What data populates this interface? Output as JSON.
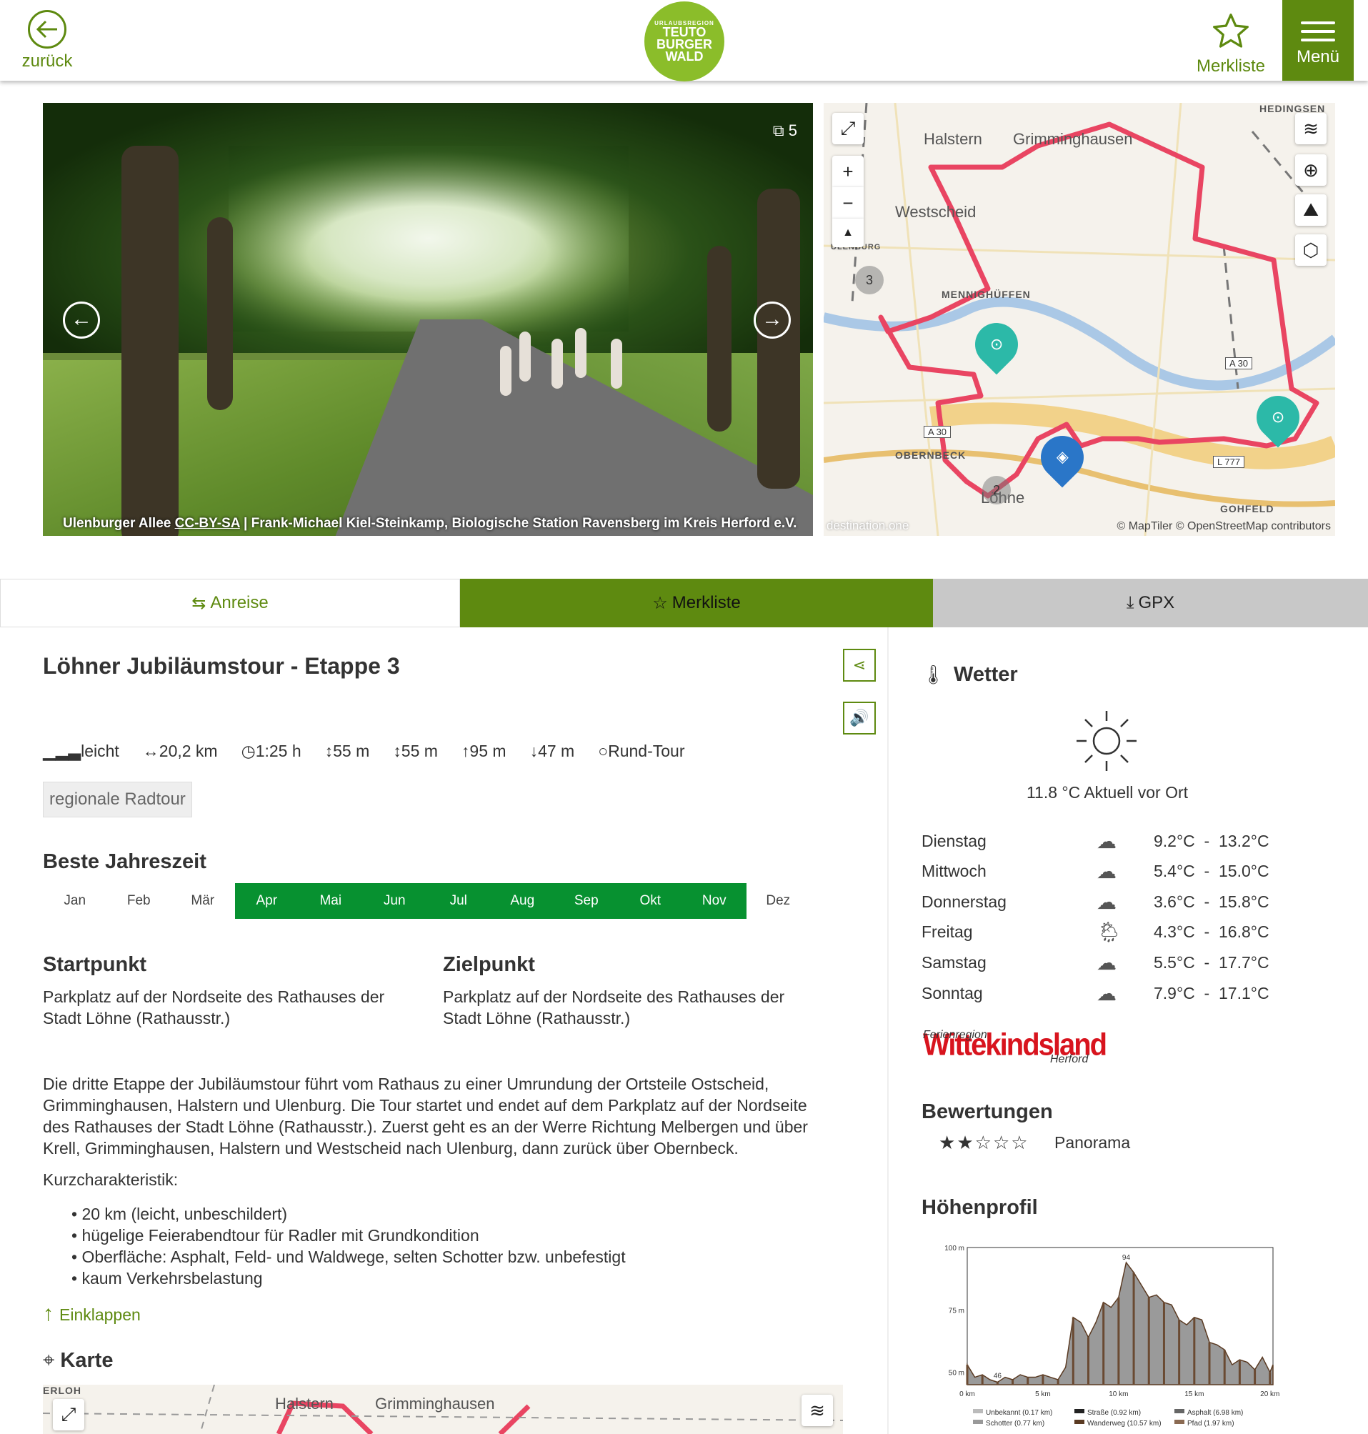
{
  "header": {
    "back_label": "zurück",
    "logo_small": "URLAUBSREGION",
    "logo_line1": "TEUTO",
    "logo_line2": "BURGER",
    "logo_line3": "WALD",
    "merkliste_label": "Merkliste",
    "menu_label": "Menü"
  },
  "gallery": {
    "count": "5",
    "caption_title": "Ulenburger Allee",
    "caption_license": "CC-BY-SA",
    "caption_author": "| Frank-Michael Kiel-Steinkamp, Biologische Station Ravensberg im Kreis Herford e.V."
  },
  "map": {
    "labels": [
      "Halstern",
      "Grimminghausen",
      "Westscheid",
      "MENNIGHÜFFEN",
      "OBERNBECK",
      "GOHFELD",
      "HEDINGSEN",
      "ULENBURG",
      "Löhne"
    ],
    "roads": [
      "A 30",
      "A 30",
      "L 777"
    ],
    "clusters": [
      "3",
      "2"
    ],
    "brand": "destination.one",
    "attribution": "© MapTiler © OpenStreetMap contributors"
  },
  "actions": {
    "anreise": "Anreise",
    "merkliste": "Merkliste",
    "gpx": "GPX"
  },
  "tour": {
    "title": "Löhner Jubiläumstour - Etappe 3",
    "stats": {
      "difficulty": "leicht",
      "distance": "20,2 km",
      "duration": "1:25 h",
      "ascent": "55 m",
      "descent": "55 m",
      "max_height": "95 m",
      "min_height": "47 m",
      "type": "Rund-Tour"
    },
    "tag": "regionale Radtour",
    "season_title": "Beste Jahreszeit",
    "months": [
      "Jan",
      "Feb",
      "Mär",
      "Apr",
      "Mai",
      "Jun",
      "Jul",
      "Aug",
      "Sep",
      "Okt",
      "Nov",
      "Dez"
    ],
    "start_title": "Startpunkt",
    "start_text": "Parkplatz auf der Nordseite des Rathauses der Stadt Löhne (Rathausstr.)",
    "end_title": "Zielpunkt",
    "end_text": "Parkplatz auf der Nordseite des Rathauses der Stadt Löhne (Rathausstr.)",
    "description": "Die dritte Etappe der Jubiläumstour führt vom Rathaus zu einer Umrundung der Ortsteile Ostscheid, Grimminghausen, Halstern und Ulenburg. Die Tour startet und endet auf dem Parkplatz auf der Nordseite des Rathauses der Stadt Löhne (Rathausstr.). Zuerst geht es an der Werre Richtung Melbergen und über Krell, Grimminghausen, Halstern und Westscheid nach Ulenburg, dann zurück über Obernbeck.",
    "kurz_title": "Kurzcharakteristik:",
    "kurz_items": [
      "20 km (leicht, unbeschildert)",
      "hügelige Feierabendtour für Radler mit Grundkondition",
      "Oberfläche: Asphalt, Feld- und Waldwege, selten Schotter bzw. unbefestigt",
      "kaum Verkehrsbelastung"
    ],
    "collapse": "Einklappen",
    "karte_title": "Karte",
    "map2_labels": [
      "ERLOH",
      "Halstern",
      "Grimminghausen"
    ]
  },
  "weather": {
    "title": "Wetter",
    "current": "11.8 °C Aktuell vor Ort",
    "days": [
      {
        "day": "Dienstag",
        "icon": "cloud-icon",
        "min": "9.2°C",
        "max": "13.2°C"
      },
      {
        "day": "Mittwoch",
        "icon": "cloud-icon",
        "min": "5.4°C",
        "max": "15.0°C"
      },
      {
        "day": "Donnerstag",
        "icon": "cloud-icon",
        "min": "3.6°C",
        "max": "15.8°C"
      },
      {
        "day": "Freitag",
        "icon": "sun-rain-icon",
        "min": "4.3°C",
        "max": "16.8°C"
      },
      {
        "day": "Samstag",
        "icon": "cloud-icon",
        "min": "5.5°C",
        "max": "17.7°C"
      },
      {
        "day": "Sonntag",
        "icon": "cloud-icon",
        "min": "7.9°C",
        "max": "17.1°C"
      }
    ]
  },
  "partner": {
    "line1": "Ferienregion",
    "name": "Wittekindsland",
    "line2": "Herford"
  },
  "ratings": {
    "title": "Bewertungen",
    "stars": 2,
    "max": 5,
    "label": "Panorama"
  },
  "profile_title": "Höhenprofil",
  "chart_data": {
    "type": "area",
    "x": [
      0,
      0.5,
      1,
      1.5,
      2,
      2.5,
      3,
      3.5,
      4,
      4.5,
      5,
      5.5,
      6,
      6.5,
      7,
      7.5,
      8,
      8.5,
      9,
      9.5,
      10,
      10.5,
      11,
      11.5,
      12,
      12.5,
      13,
      13.5,
      14,
      14.5,
      15,
      15.5,
      16,
      16.5,
      17,
      17.5,
      18,
      18.5,
      19,
      19.5,
      20,
      20.2
    ],
    "y": [
      53,
      48,
      49,
      47,
      46,
      48,
      47,
      49,
      48,
      48,
      49,
      48,
      47,
      52,
      72,
      70,
      64,
      70,
      78,
      76,
      80,
      94,
      90,
      85,
      80,
      81,
      78,
      77,
      71,
      69,
      72,
      71,
      62,
      61,
      59,
      53,
      55,
      54,
      51,
      56,
      50,
      53
    ],
    "xlabel": "",
    "ylabel": "",
    "xticks": [
      "0 km",
      "5 km",
      "10 km",
      "15 km",
      "20 km"
    ],
    "yticks": [
      "50 m",
      "75 m",
      "100 m"
    ],
    "xlim": [
      0,
      20.2
    ],
    "ylim": [
      45,
      100
    ],
    "annotations": [
      "94",
      "46"
    ],
    "legend": [
      "Unbekannt (0.17 km)",
      "Straße (0.92 km)",
      "Asphalt (6.98 km)",
      "Schotter (0.77 km)",
      "Wanderweg (10.57 km)",
      "Pfad (1.97 km)"
    ]
  }
}
